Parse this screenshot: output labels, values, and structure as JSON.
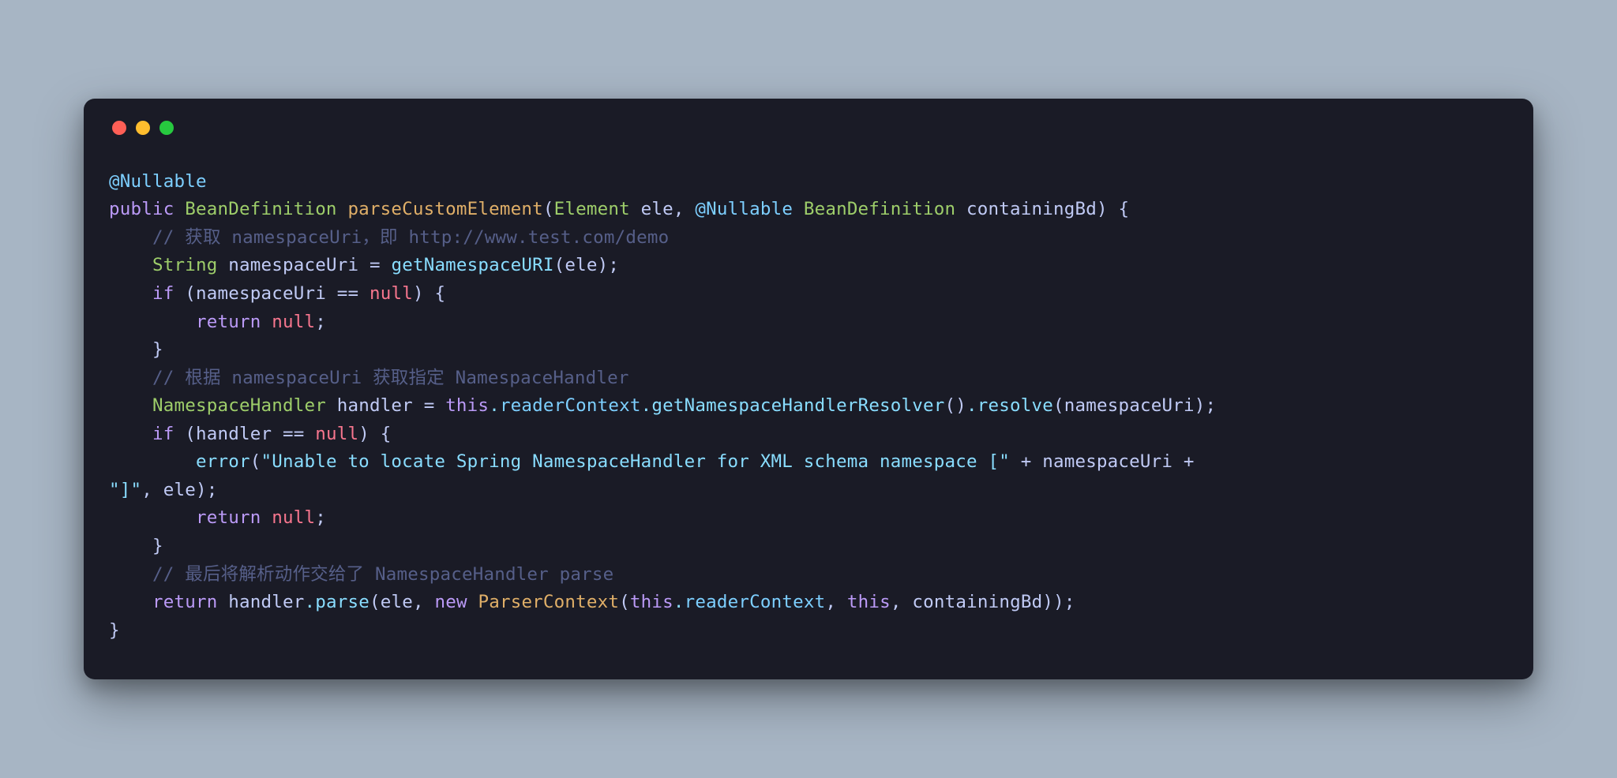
{
  "window": {
    "traffic_light_colors": {
      "red": "#ff5f56",
      "yellow": "#ffbd2e",
      "green": "#27c93f"
    }
  },
  "code": {
    "line1_annotation": "@Nullable",
    "line2_public": "public",
    "line2_type": "BeanDefinition",
    "line2_method": "parseCustomElement",
    "line2_param1_type": "Element",
    "line2_param1_name": "ele",
    "line2_anno": "@Nullable",
    "line2_param2_type": "BeanDefinition",
    "line2_param2_name": "containingBd",
    "line3_comment": "// 获取 namespaceUri，即 http://www.test.com/demo",
    "line4_type": "String",
    "line4_var": "namespaceUri",
    "line4_call": "getNamespaceURI",
    "line4_arg": "ele",
    "line5_if": "if",
    "line5_var": "namespaceUri",
    "line5_null": "null",
    "line6_return": "return",
    "line6_null": "null",
    "line8_comment": "// 根据 namespaceUri 获取指定 NamespaceHandler",
    "line9_type": "NamespaceHandler",
    "line9_var": "handler",
    "line9_this": "this",
    "line9_prop": "readerContext",
    "line9_call1": "getNamespaceHandlerResolver",
    "line9_call2": "resolve",
    "line9_arg": "namespaceUri",
    "line10_if": "if",
    "line10_var": "handler",
    "line10_null": "null",
    "line11_call": "error",
    "line11_str1": "\"Unable to locate Spring NamespaceHandler for XML schema namespace [\"",
    "line11_var": "namespaceUri",
    "line12_str2": "\"]\"",
    "line12_arg": "ele",
    "line13_return": "return",
    "line13_null": "null",
    "line15_comment": "// 最后将解析动作交给了 NamespaceHandler parse",
    "line16_return": "return",
    "line16_var": "handler",
    "line16_call": "parse",
    "line16_arg1": "ele",
    "line16_new": "new",
    "line16_ctor": "ParserContext",
    "line16_this1": "this",
    "line16_prop": "readerContext",
    "line16_this2": "this",
    "line16_arg4": "containingBd"
  }
}
